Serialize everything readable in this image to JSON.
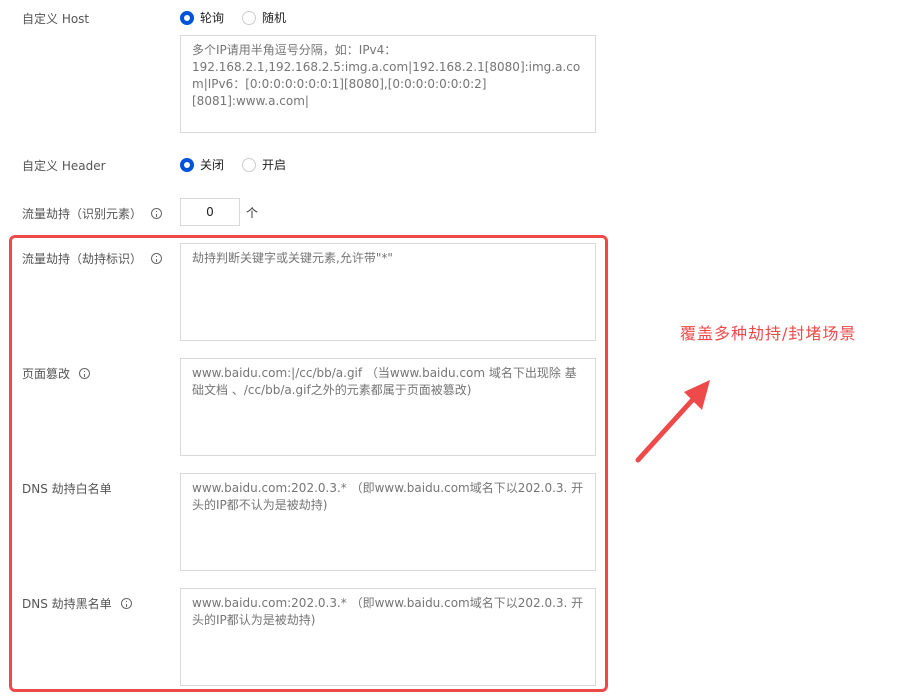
{
  "custom_host": {
    "label": "自定义 Host",
    "options": [
      {
        "label": "轮询",
        "checked": true
      },
      {
        "label": "随机",
        "checked": false
      }
    ],
    "placeholder": "多个IP请用半角逗号分隔，如：IPv4：192.168.2.1,192.168.2.5:img.a.com|192.168.2.1[8080]:img.a.com|IPv6：[0:0:0:0:0:0:0:1][8080],[0:0:0:0:0:0:0:2][8081]:www.a.com|"
  },
  "custom_header": {
    "label": "自定义 Header",
    "options": [
      {
        "label": "关闭",
        "checked": true
      },
      {
        "label": "开启",
        "checked": false
      }
    ]
  },
  "hijack_elements": {
    "label": "流量劫持（识别元素）",
    "value": "0",
    "unit": "个"
  },
  "hijack_marker": {
    "label": "流量劫持（劫持标识）",
    "placeholder": "劫持判断关键字或关键元素,允许带\"*\""
  },
  "page_tamper": {
    "label": "页面篡改",
    "placeholder": "www.baidu.com:|/cc/bb/a.gif （当www.baidu.com 域名下出现除 基础文档 、/cc/bb/a.gif之外的元素都属于页面被篡改)"
  },
  "dns_whitelist": {
    "label": "DNS 劫持白名单",
    "placeholder": "www.baidu.com:202.0.3.* （即www.baidu.com域名下以202.0.3. 开头的IP都不认为是被劫持)"
  },
  "dns_blacklist": {
    "label": "DNS 劫持黑名单",
    "placeholder": "www.baidu.com:202.0.3.* （即www.baidu.com域名下以202.0.3. 开头的IP都认为是被劫持)"
  },
  "annotation": {
    "text": "覆盖多种劫持/封堵场景",
    "color": "#ee4a4a"
  },
  "colors": {
    "accent": "#0052d9",
    "highlight": "#ee4a4a"
  }
}
